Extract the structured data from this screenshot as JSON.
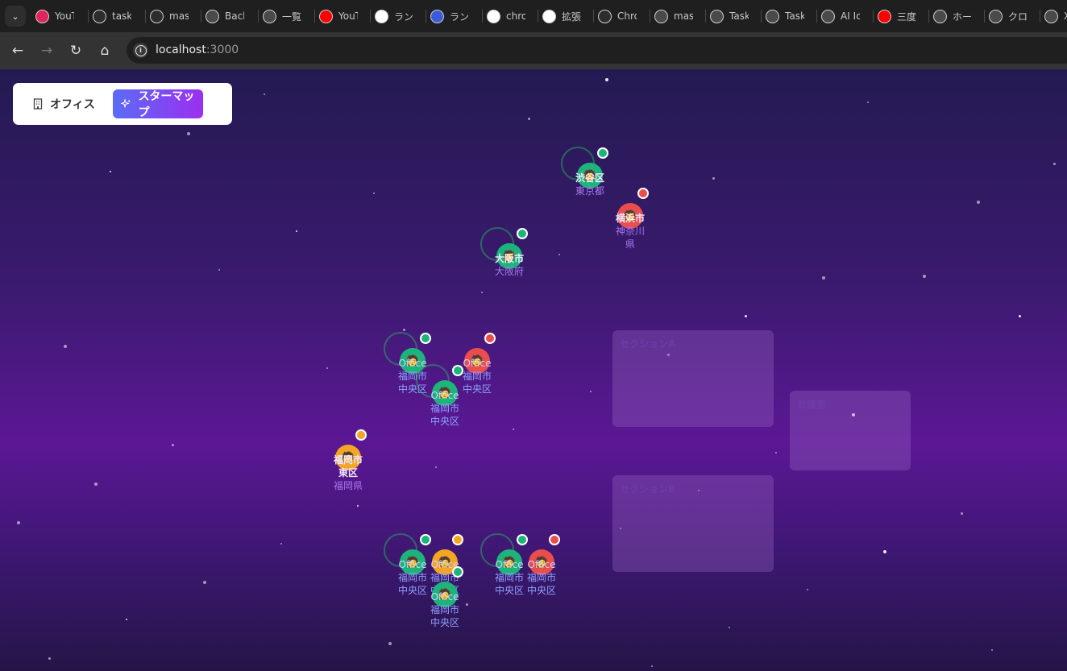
{
  "browser": {
    "menu_icon": "chevron-down-icon",
    "tabs": [
      {
        "label": "YouT",
        "icon": "youtube-music-icon",
        "color": "#e0245e"
      },
      {
        "label": "task",
        "icon": "bolt-app-icon",
        "color": "#2d2d2d"
      },
      {
        "label": "mas",
        "icon": "bolt-app-icon",
        "color": "#2d2d2d"
      },
      {
        "label": "Back",
        "icon": "github-icon",
        "color": "#4a4a4a"
      },
      {
        "label": "一覧",
        "icon": "github-icon",
        "color": "#4a4a4a"
      },
      {
        "label": "YouT",
        "icon": "youtube-icon",
        "color": "#ff0000"
      },
      {
        "label": "ランキ",
        "icon": "google-icon",
        "color": "#ffffff"
      },
      {
        "label": "ランキ",
        "icon": "l-logo-icon",
        "color": "#3b5bdb"
      },
      {
        "label": "chro",
        "icon": "google-icon",
        "color": "#ffffff"
      },
      {
        "label": "拡張",
        "icon": "google-icon",
        "color": "#ffffff"
      },
      {
        "label": "Chro",
        "icon": "slash-logo-icon",
        "color": "#2d2d2d"
      },
      {
        "label": "mas",
        "icon": "github-icon",
        "color": "#4a4a4a"
      },
      {
        "label": "Task",
        "icon": "openai-icon",
        "color": "#4a4a4a"
      },
      {
        "label": "Task",
        "icon": "openai-icon",
        "color": "#4a4a4a"
      },
      {
        "label": "AI Ic",
        "icon": "openai-icon",
        "color": "#4a4a4a"
      },
      {
        "label": "三度",
        "icon": "youtube-icon",
        "color": "#ff0000"
      },
      {
        "label": "ホーム",
        "icon": "x-logo-icon",
        "color": "#4a4a4a"
      },
      {
        "label": "クロー",
        "icon": "ai-logo-icon",
        "color": "#4a4a4a"
      },
      {
        "label": "X",
        "icon": "x-logo-icon",
        "color": "#4a4a4a"
      }
    ],
    "url_host": "localhost",
    "url_port": ":3000"
  },
  "view_toggle": {
    "office_label": "オフィス",
    "office_icon": "building-icon",
    "starmap_label": "スターマップ",
    "starmap_icon": "sparkles-icon",
    "active": "starmap"
  },
  "sections": [
    {
      "label": "セクションA"
    },
    {
      "label": "会議室"
    },
    {
      "label": "セクションB"
    }
  ],
  "nodes": [
    {
      "line1": "渋谷区",
      "line2": "東京都",
      "status": "online",
      "status_color": "#1db47c",
      "avatar_color": "#1db47c",
      "avatar_icon": "person-icon"
    },
    {
      "line1": "横浜市",
      "line2": "神奈川県",
      "status": "busy",
      "status_color": "#ea4d4d",
      "avatar_color": "#ea4d4d",
      "avatar_icon": "person-icon"
    },
    {
      "line1": "大阪市",
      "line2": "大阪府",
      "status": "online",
      "status_color": "#1db47c",
      "avatar_color": "#1db47c",
      "avatar_icon": "person-icon"
    },
    {
      "line1": "Office",
      "line2": "福岡市中央区",
      "status": "online",
      "status_color": "#1db47c",
      "avatar_color": "#1db47c",
      "avatar_icon": "person-icon"
    },
    {
      "line1": "Office",
      "line2": "福岡市中央区",
      "status": "busy",
      "status_color": "#ea4d4d",
      "avatar_color": "#ea4d4d",
      "avatar_icon": "person-icon"
    },
    {
      "line1": "Office",
      "line2": "福岡市中央区",
      "status": "online",
      "status_color": "#1db47c",
      "avatar_color": "#1db47c",
      "avatar_icon": "person-icon"
    },
    {
      "line1": "福岡市東区",
      "line2": "福岡県",
      "status": "away",
      "status_color": "#f5a524",
      "avatar_color": "#f5a524",
      "avatar_icon": "person-icon"
    },
    {
      "line1": "Office",
      "line2": "福岡市中央区",
      "status": "online",
      "status_color": "#1db47c",
      "avatar_color": "#1db47c",
      "avatar_icon": "person-icon"
    },
    {
      "line1": "Office",
      "line2": "福岡市中央区",
      "status": "away",
      "status_color": "#f5a524",
      "avatar_color": "#f5a524",
      "avatar_icon": "person-icon"
    },
    {
      "line1": "Office",
      "line2": "福岡市中央区",
      "status": "online",
      "status_color": "#1db47c",
      "avatar_color": "#1db47c",
      "avatar_icon": "person-icon"
    },
    {
      "line1": "Office",
      "line2": "福岡市中央区",
      "status": "online",
      "status_color": "#1db47c",
      "avatar_color": "#1db47c",
      "avatar_icon": "person-icon"
    },
    {
      "line1": "Office",
      "line2": "福岡市中央区",
      "status": "busy",
      "status_color": "#ea4d4d",
      "avatar_color": "#ea4d4d",
      "avatar_icon": "person-icon"
    }
  ]
}
